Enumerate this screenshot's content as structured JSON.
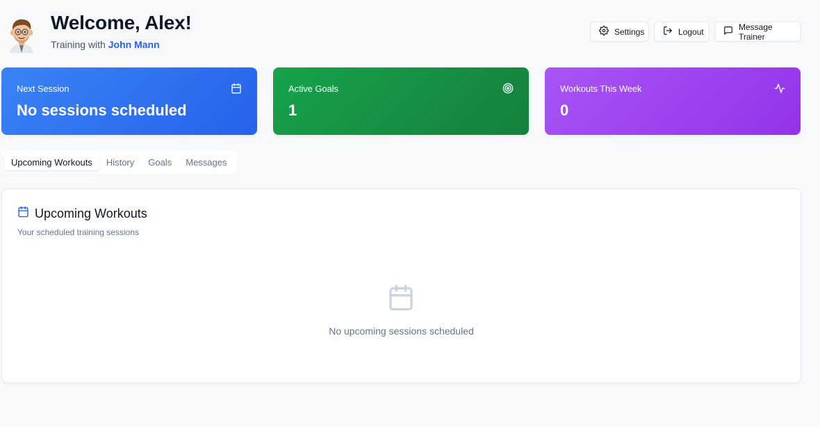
{
  "header": {
    "welcome": "Welcome, Alex!",
    "subtitle_prefix": "Training with",
    "trainer_name": "John Mann",
    "buttons": {
      "settings": "Settings",
      "logout": "Logout",
      "message_trainer": "Message Trainer"
    }
  },
  "stats": [
    {
      "label": "Next Session",
      "value": "No sessions scheduled",
      "icon": "calendar-icon",
      "color": "#3b82f6"
    },
    {
      "label": "Active Goals",
      "value": "1",
      "icon": "target-icon",
      "color": "#16a34a"
    },
    {
      "label": "Workouts This Week",
      "value": "0",
      "icon": "activity-icon",
      "color": "#a855f7"
    }
  ],
  "tabs": [
    {
      "label": "Upcoming Workouts",
      "active": true
    },
    {
      "label": "History",
      "active": false
    },
    {
      "label": "Goals",
      "active": false
    },
    {
      "label": "Messages",
      "active": false
    }
  ],
  "panel": {
    "title": "Upcoming Workouts",
    "description": "Your scheduled training sessions",
    "empty_message": "No upcoming sessions scheduled"
  },
  "colors": {
    "accent": "#2563eb",
    "background": "#f8f9fb"
  }
}
